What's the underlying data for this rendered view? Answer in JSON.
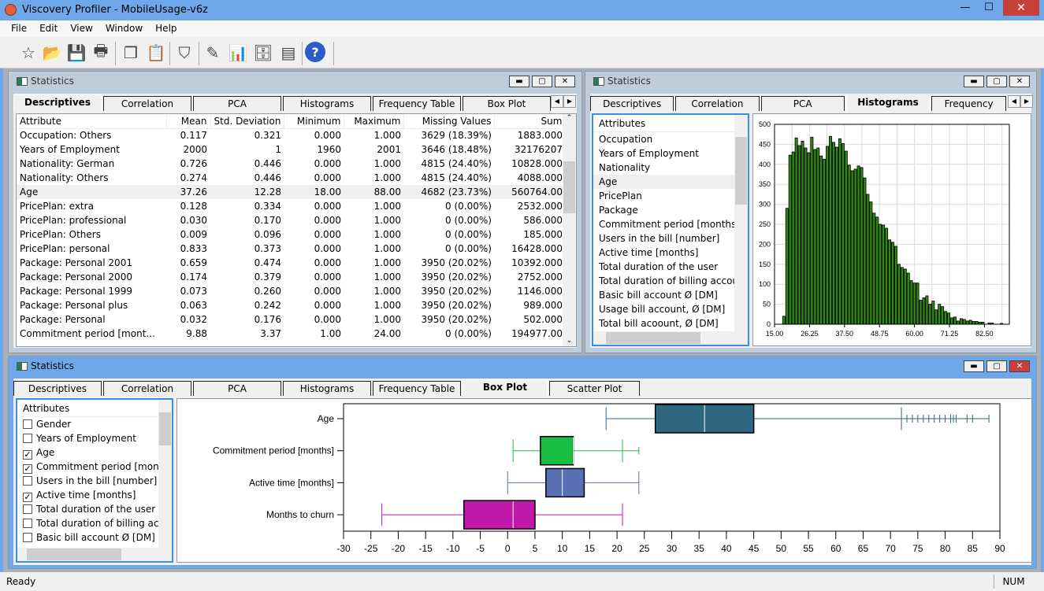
{
  "app": {
    "title": "Viscovery Profiler - MobileUsage-v6z"
  },
  "menu": [
    "File",
    "Edit",
    "View",
    "Window",
    "Help"
  ],
  "toolbar": [
    "new-icon",
    "open-icon",
    "save-icon",
    "print-icon",
    "copy-icon",
    "paste-icon",
    "tag-icon",
    "edit-icon",
    "chart-icon",
    "database-icon",
    "pages-icon",
    "help-icon"
  ],
  "windows": {
    "top_left": {
      "title": "Statistics",
      "tabs": [
        "Descriptives",
        "Correlation",
        "PCA",
        "Histograms",
        "Frequency Table",
        "Box Plot"
      ],
      "selected_tab": "Descriptives",
      "table": {
        "columns": [
          "Attribute",
          "Mean",
          "Std. Deviation",
          "Minimum",
          "Maximum",
          "Missing Values",
          "Sum"
        ],
        "rows": [
          [
            "Occupation: Others",
            "0.117",
            "0.321",
            "0.000",
            "1.000",
            "3629 (18.39%)",
            "1883.000"
          ],
          [
            "Years of Employment",
            "2000",
            "1",
            "1960",
            "2001",
            "3646 (18.48%)",
            "32176207"
          ],
          [
            "Nationality: German",
            "0.726",
            "0.446",
            "0.000",
            "1.000",
            "4815 (24.40%)",
            "10828.000"
          ],
          [
            "Nationality: Others",
            "0.274",
            "0.446",
            "0.000",
            "1.000",
            "4815 (24.40%)",
            "4088.000"
          ],
          [
            "Age",
            "37.26",
            "12.28",
            "18.00",
            "88.00",
            "4682 (23.73%)",
            "560764.00"
          ],
          [
            "PricePlan: extra",
            "0.128",
            "0.334",
            "0.000",
            "1.000",
            "0 (0.00%)",
            "2532.000"
          ],
          [
            "PricePlan: professional",
            "0.030",
            "0.170",
            "0.000",
            "1.000",
            "0 (0.00%)",
            "586.000"
          ],
          [
            "PricePlan: Others",
            "0.009",
            "0.096",
            "0.000",
            "1.000",
            "0 (0.00%)",
            "185.000"
          ],
          [
            "PricePlan: personal",
            "0.833",
            "0.373",
            "0.000",
            "1.000",
            "0 (0.00%)",
            "16428.000"
          ],
          [
            "Package: Personal 2001",
            "0.659",
            "0.474",
            "0.000",
            "1.000",
            "3950 (20.02%)",
            "10392.000"
          ],
          [
            "Package: Personal 2000",
            "0.174",
            "0.379",
            "0.000",
            "1.000",
            "3950 (20.02%)",
            "2752.000"
          ],
          [
            "Package: Personal 1999",
            "0.073",
            "0.260",
            "0.000",
            "1.000",
            "3950 (20.02%)",
            "1146.000"
          ],
          [
            "Package: Personal plus",
            "0.063",
            "0.242",
            "0.000",
            "1.000",
            "3950 (20.02%)",
            "989.000"
          ],
          [
            "Package: Personal",
            "0.032",
            "0.176",
            "0.000",
            "1.000",
            "3950 (20.02%)",
            "502.000"
          ],
          [
            "Commitment period [mont...",
            "9.88",
            "3.37",
            "1.00",
            "24.00",
            "0 (0.00%)",
            "194977.00"
          ]
        ],
        "selected_row": "Age"
      }
    },
    "top_right": {
      "title": "Statistics",
      "tabs": [
        "Descriptives",
        "Correlation",
        "PCA",
        "Histograms",
        "Frequency"
      ],
      "selected_tab": "Histograms",
      "list_header": "Attributes",
      "attributes": [
        "Occupation",
        "Years of Employment",
        "Nationality",
        "Age",
        "PricePlan",
        "Package",
        "Commitment period [months]",
        "Users in the bill [number]",
        "Active time [months]",
        "Total duration of the user",
        "Total duration of billing account",
        "Basic bill account Ø [DM]",
        "Usage bill account, Ø [DM]",
        "Total bill acoount, Ø [DM]"
      ],
      "selected_attribute": "Age"
    },
    "bottom": {
      "title": "Statistics",
      "tabs": [
        "Descriptives",
        "Correlation",
        "PCA",
        "Histograms",
        "Frequency Table",
        "Box Plot",
        "Scatter Plot"
      ],
      "selected_tab": "Box Plot",
      "list_header": "Attributes",
      "attributes": [
        {
          "label": "Gender",
          "checked": false
        },
        {
          "label": "Years of Employment",
          "checked": false
        },
        {
          "label": "Age",
          "checked": true
        },
        {
          "label": "Commitment period [months]",
          "checked": true
        },
        {
          "label": "Users in the bill [number]",
          "checked": false
        },
        {
          "label": "Active time [months]",
          "checked": true
        },
        {
          "label": "Total duration of the user",
          "checked": false
        },
        {
          "label": "Total duration of billing account",
          "checked": false
        },
        {
          "label": "Basic bill account Ø [DM]",
          "checked": false
        }
      ]
    }
  },
  "chart_data": [
    {
      "type": "bar",
      "subtype": "histogram",
      "bar_color": "#2e8b14",
      "grid": true,
      "x_ticks": [
        "15.00",
        "26.25",
        "37.50",
        "48.75",
        "60.00",
        "71.25",
        "82.50"
      ],
      "y_ticks": [
        "0",
        "50",
        "100",
        "150",
        "200",
        "250",
        "300",
        "350",
        "400",
        "450",
        "500"
      ],
      "xlim": [
        15,
        90.5
      ],
      "ylim": [
        0,
        500
      ],
      "x": [
        18,
        19,
        20,
        21,
        22,
        23,
        24,
        25,
        26,
        27,
        28,
        29,
        30,
        31,
        32,
        33,
        34,
        35,
        36,
        37,
        38,
        39,
        40,
        41,
        42,
        43,
        44,
        45,
        46,
        47,
        48,
        49,
        50,
        51,
        52,
        53,
        54,
        55,
        56,
        57,
        58,
        59,
        60,
        61,
        62,
        63,
        64,
        65,
        66,
        67,
        68,
        69,
        70,
        71,
        72,
        73,
        74,
        75,
        76,
        77,
        78,
        79,
        80,
        81,
        82,
        83,
        84,
        85,
        86,
        87,
        88
      ],
      "values": [
        20,
        290,
        423,
        431,
        466,
        447,
        458,
        441,
        429,
        468,
        437,
        441,
        421,
        413,
        445,
        470,
        455,
        443,
        464,
        452,
        433,
        398,
        384,
        388,
        396,
        392,
        366,
        325,
        306,
        278,
        268,
        250,
        248,
        240,
        211,
        205,
        195,
        150,
        142,
        138,
        128,
        109,
        103,
        103,
        60,
        66,
        71,
        50,
        58,
        36,
        50,
        44,
        32,
        28,
        16,
        18,
        8,
        14,
        12,
        8,
        10,
        7,
        7,
        5,
        5,
        0,
        3,
        3,
        0,
        0,
        2
      ]
    },
    {
      "type": "boxplot",
      "xlim": [
        -30,
        90
      ],
      "x_ticks": [
        "-30",
        "-25",
        "-20",
        "-15",
        "-10",
        "-5",
        "0",
        "5",
        "10",
        "15",
        "20",
        "25",
        "30",
        "35",
        "40",
        "45",
        "50",
        "55",
        "60",
        "65",
        "70",
        "75",
        "80",
        "85",
        "90"
      ],
      "series": [
        {
          "name": "Age",
          "color": "#2f6680",
          "whisker_low": 18,
          "q1": 27,
          "median": 36,
          "q3": 45,
          "whisker_high": 72,
          "outliers": [
            73,
            74,
            75,
            76,
            77,
            78,
            79,
            80,
            81,
            81.5,
            82,
            84,
            85,
            88
          ]
        },
        {
          "name": "Commitment period [months]",
          "color": "#19bf40",
          "whisker_low": 1,
          "q1": 6,
          "median": 12,
          "q3": 12,
          "whisker_high": 21,
          "outliers": [
            24
          ]
        },
        {
          "name": "Active time [months]",
          "color": "#5a6fb4",
          "whisker_low": 0,
          "q1": 7,
          "median": 10,
          "q3": 14,
          "whisker_high": 24,
          "outliers": []
        },
        {
          "name": "Months to churn",
          "color": "#c018a8",
          "whisker_low": -23,
          "q1": -8,
          "median": 1,
          "q3": 5,
          "whisker_high": 21,
          "outliers": []
        }
      ]
    }
  ],
  "status": {
    "text": "Ready",
    "num": "NUM"
  }
}
